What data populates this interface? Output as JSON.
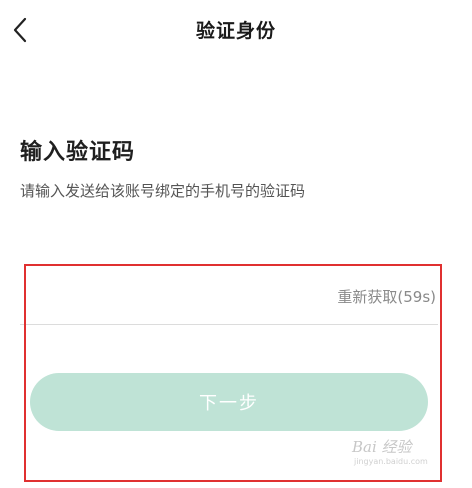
{
  "nav": {
    "title": "验证身份",
    "back_icon": "chevron-left-icon"
  },
  "content": {
    "heading": "输入验证码",
    "subtitle": "请输入发送给该账号绑定的手机号的验证码"
  },
  "code_field": {
    "value": "",
    "placeholder": "",
    "resend_label": "重新获取(59s)"
  },
  "next_button": {
    "label": "下一步"
  },
  "watermark": {
    "text": "Bai 经验",
    "subtext": "jingyan.baidu.com"
  },
  "colors": {
    "accent_disabled": "#bfe3d6",
    "highlight_border": "#e03030",
    "resend_text": "#8a8a8a"
  }
}
